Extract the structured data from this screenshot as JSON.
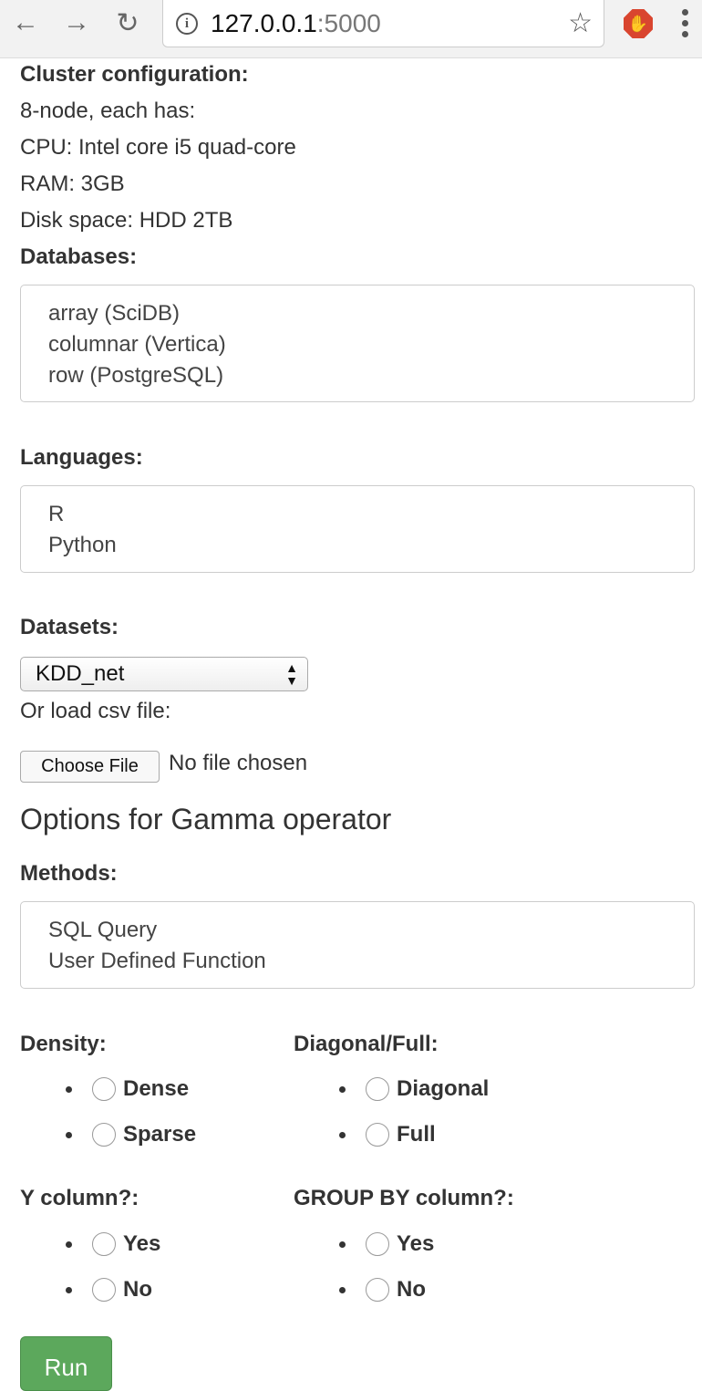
{
  "browser": {
    "url_host": "127.0.0.1",
    "url_port": ":5000"
  },
  "cluster": {
    "title": "Cluster configuration:",
    "lines": [
      "8-node, each has:",
      "CPU: Intel core i5 quad-core",
      "RAM: 3GB",
      "Disk space: HDD 2TB"
    ]
  },
  "databases": {
    "label": "Databases:",
    "options": [
      "array (SciDB)",
      "columnar (Vertica)",
      "row (PostgreSQL)"
    ]
  },
  "languages": {
    "label": "Languages:",
    "options": [
      "R",
      "Python"
    ]
  },
  "datasets": {
    "label": "Datasets:",
    "selected": "KDD_net",
    "csv_label": "Or load csv file:",
    "choose_file": "Choose File",
    "no_file": "No file chosen"
  },
  "gamma": {
    "heading": "Options for Gamma operator",
    "methods_label": "Methods:",
    "methods": [
      "SQL Query",
      "User Defined Function"
    ]
  },
  "density": {
    "label": "Density:",
    "options": [
      "Dense",
      "Sparse"
    ]
  },
  "diagonal": {
    "label": "Diagonal/Full:",
    "options": [
      "Diagonal",
      "Full"
    ]
  },
  "ycol": {
    "label": "Y column?:",
    "options": [
      "Yes",
      "No"
    ]
  },
  "groupby": {
    "label": "GROUP BY column?:",
    "options": [
      "Yes",
      "No"
    ]
  },
  "run_label": "Run"
}
